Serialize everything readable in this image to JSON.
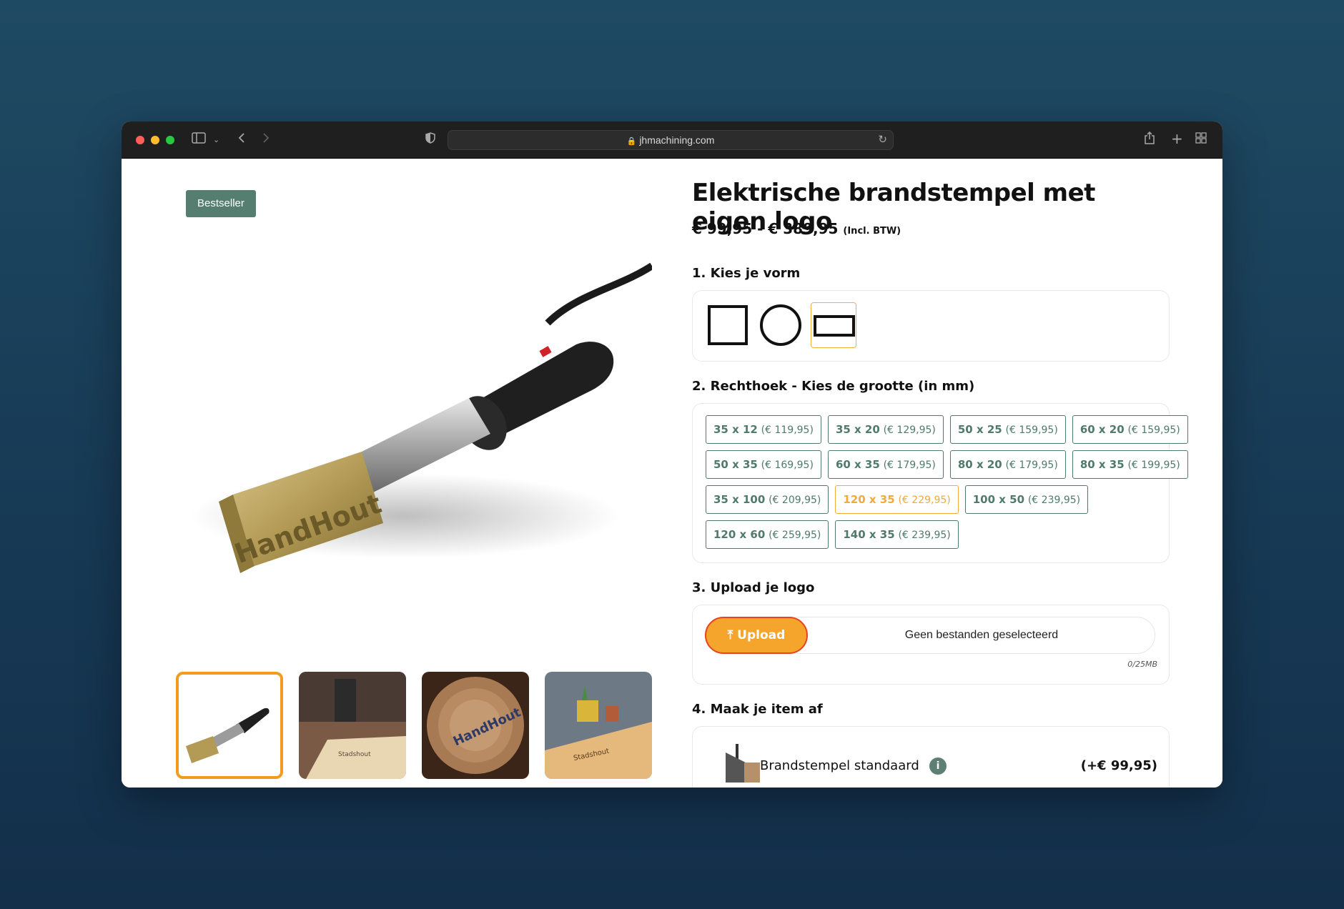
{
  "browser": {
    "url": "jhmachining.com"
  },
  "product": {
    "badge": "Bestseller",
    "title": "Elektrische brandstempel met eigen logo",
    "price_range": "€ 99,95 - € 389,95",
    "price_note": "(Incl. BTW)"
  },
  "steps": {
    "shape": {
      "label": "1. Kies je vorm",
      "options": [
        "square-icon",
        "circle-icon",
        "rectangle-icon"
      ],
      "selected": "rectangle"
    },
    "size": {
      "label": "2. Rechthoek - Kies de grootte (in mm)",
      "rows": [
        [
          {
            "size": "35 x 12",
            "price": "(€ 119,95)"
          },
          {
            "size": "35 x 20",
            "price": "(€ 129,95)"
          },
          {
            "size": "50 x 25",
            "price": "(€ 159,95)"
          },
          {
            "size": "60 x 20",
            "price": "(€ 159,95)"
          }
        ],
        [
          {
            "size": "50 x 35",
            "price": "(€ 169,95)"
          },
          {
            "size": "60 x 35",
            "price": "(€ 179,95)"
          },
          {
            "size": "80 x 20",
            "price": "(€ 179,95)"
          },
          {
            "size": "80 x 35",
            "price": "(€ 199,95)"
          }
        ],
        [
          {
            "size": "35 x 100",
            "price": "(€ 209,95)"
          },
          {
            "size": "120 x 35",
            "price": "(€ 229,95)",
            "selected": true
          },
          {
            "size": "100 x 50",
            "price": "(€ 239,95)"
          }
        ],
        [
          {
            "size": "120 x 60",
            "price": "(€ 259,95)"
          },
          {
            "size": "140 x 35",
            "price": "(€ 239,95)"
          }
        ]
      ]
    },
    "upload": {
      "label": "3. Upload je logo",
      "button": "Upload",
      "status": "Geen bestanden geselecteerd",
      "limit": "0/25MB"
    },
    "finish": {
      "label": "4. Maak je item af",
      "addon_name": "Brandstempel standaard",
      "addon_price": "(+€ 99,95)",
      "info": "i"
    }
  },
  "colors": {
    "accent_orange": "#f5a52b",
    "brand_green": "#557d70"
  }
}
